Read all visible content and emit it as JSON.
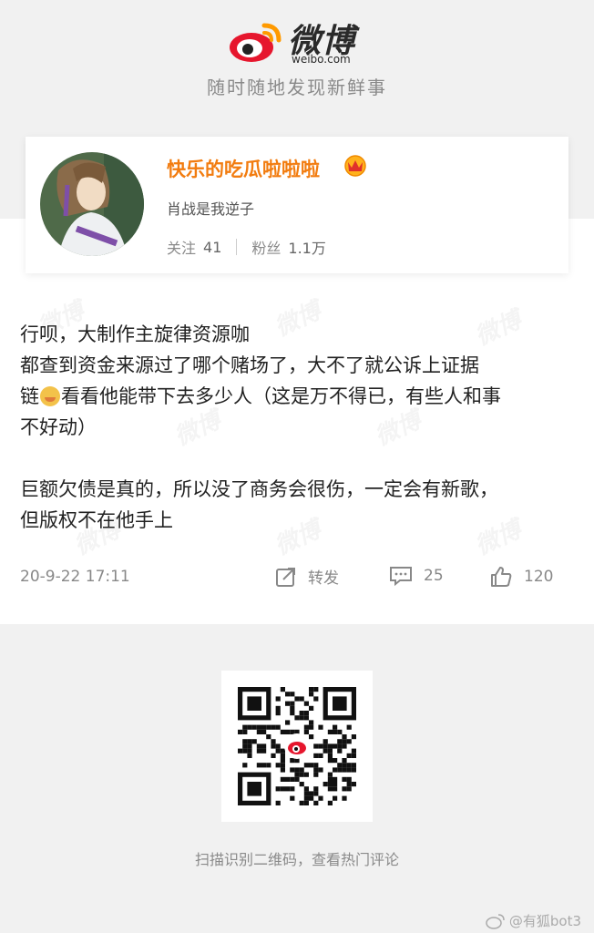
{
  "header": {
    "logo_text": "微博",
    "logo_domain": "weibo.com",
    "slogan": "随时随地发现新鲜事",
    "brand_red": "#e6162d",
    "brand_orange": "#ff9a00"
  },
  "profile": {
    "username": "快乐的吃瓜啦啦啦",
    "bio": "肖战是我逆子",
    "follow_label": "关注",
    "follow_count": "41",
    "fans_label": "粉丝",
    "fans_count": "1.1万",
    "name_color": "#f27c0f",
    "badge_icon": "vip-crown-icon"
  },
  "post": {
    "line1": "行呗，大制作主旋律资源咖",
    "line2": "都查到资金来源过了哪个赌场了，大不了就公诉上证据",
    "line3a": "链",
    "line3b": "看看他能带下去多少人（这是万不得已，有些人和事",
    "line4": "不好动）",
    "line5": "巨额欠债是真的，所以没了商务会很伤，一定会有新歌，",
    "line6": "但版权不在他手上"
  },
  "meta": {
    "time": "20-9-22 17:11",
    "repost_label": "转发",
    "comment_count": "25",
    "like_count": "120"
  },
  "qr": {
    "hint": "扫描识别二维码，查看热门评论"
  },
  "watermark": {
    "text": "微博",
    "credit": "@有狐bot3"
  }
}
